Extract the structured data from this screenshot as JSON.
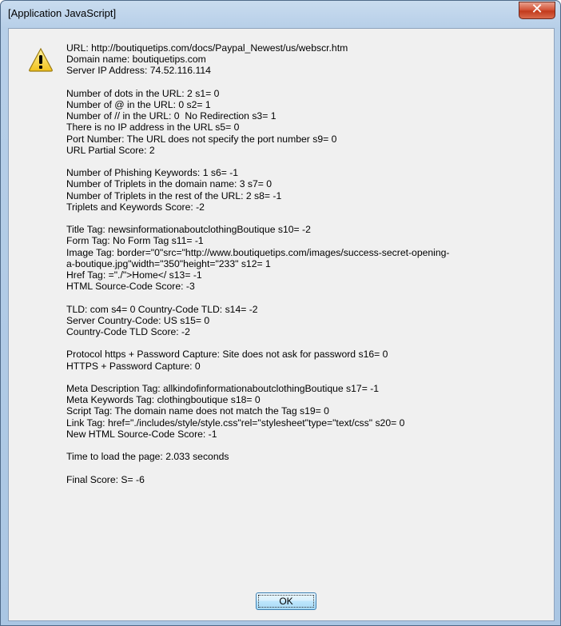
{
  "window": {
    "title": "[Application JavaScript]",
    "close_icon": "close-icon"
  },
  "dialog": {
    "icon": "warning-icon",
    "lines": [
      "URL: http://boutiquetips.com/docs/Paypal_Newest/us/webscr.htm",
      "Domain name: boutiquetips.com",
      "Server IP Address: 74.52.116.114",
      "",
      "Number of dots in the URL: 2 s1= 0",
      "Number of @ in the URL: 0 s2= 1",
      "Number of // in the URL: 0  No Redirection s3= 1",
      "There is no IP address in the URL s5= 0",
      "Port Number: The URL does not specify the port number s9= 0",
      "URL Partial Score: 2",
      "",
      "Number of Phishing Keywords: 1 s6= -1",
      "Number of Triplets in the domain name: 3 s7= 0",
      "Number of Triplets in the rest of the URL: 2 s8= -1",
      "Triplets and Keywords Score: -2",
      "",
      "Title Tag: newsinformationaboutclothingBoutique s10= -2",
      "Form Tag: No Form Tag s11= -1",
      "Image Tag: border=\"0\"src=\"http://www.boutiquetips.com/images/success-secret-opening-",
      "a-boutique.jpg\"width=\"350\"height=\"233\" s12= 1",
      "Href Tag: =\"./\">Home</ s13= -1",
      "HTML Source-Code Score: -3",
      "",
      "TLD: com s4= 0 Country-Code TLD: s14= -2",
      "Server Country-Code: US s15= 0",
      "Country-Code TLD Score: -2",
      "",
      "Protocol https + Password Capture: Site does not ask for password s16= 0",
      "HTTPS + Password Capture: 0",
      "",
      "Meta Description Tag: allkindofinformationaboutclothingBoutique s17= -1",
      "Meta Keywords Tag: clothingboutique s18= 0",
      "Script Tag: The domain name does not match the Tag s19= 0",
      "Link Tag: href=\"./includes/style/style.css\"rel=\"stylesheet\"type=\"text/css\" s20= 0",
      "New HTML Source-Code Score: -1",
      "",
      "Time to load the page: 2.033 seconds",
      "",
      "Final Score: S= -6"
    ],
    "ok_label": "OK"
  }
}
